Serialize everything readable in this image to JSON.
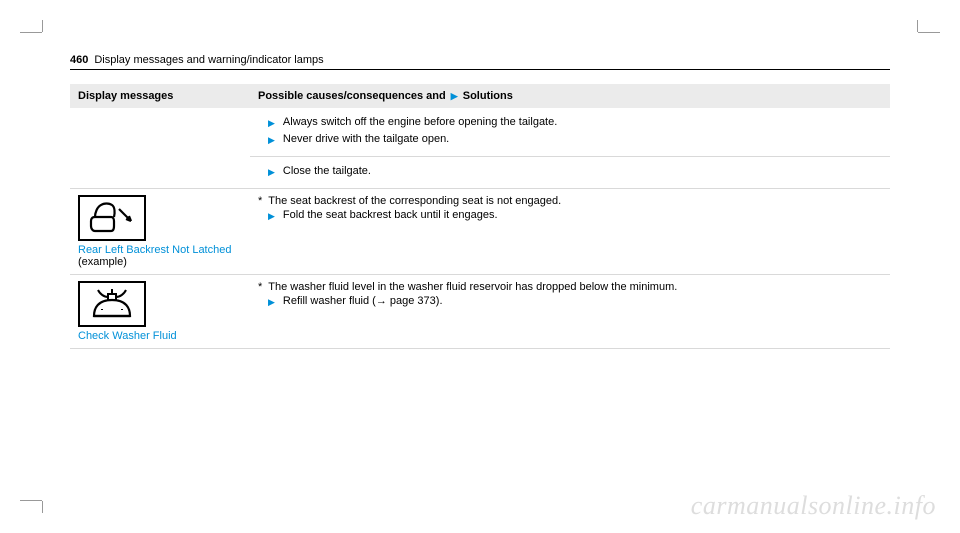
{
  "header": {
    "page_num": "460",
    "chapter": "Display messages and warning/indicator lamps"
  },
  "table_headers": {
    "col1": "Display messages",
    "col2_a": "Possible causes/consequences and",
    "col2_b": "Solutions"
  },
  "row1": {
    "b1": "Always switch off the engine before opening the tailgate.",
    "b2": "Never drive with the tailgate open.",
    "b3": "Close the tailgate."
  },
  "row2": {
    "label": "Rear Left Backrest Not Latched",
    "label_suffix": " (example)",
    "cause": "The seat backrest of the corresponding seat is not engaged.",
    "sol": "Fold the seat backrest back until it engages."
  },
  "row3": {
    "label": "Check Washer Fluid",
    "cause": "The washer fluid level in the washer fluid reservoir has dropped below the minimum.",
    "sol_a": "Refill washer fluid (",
    "sol_b": " page 373)."
  },
  "watermark": "carmanualsonline.info"
}
